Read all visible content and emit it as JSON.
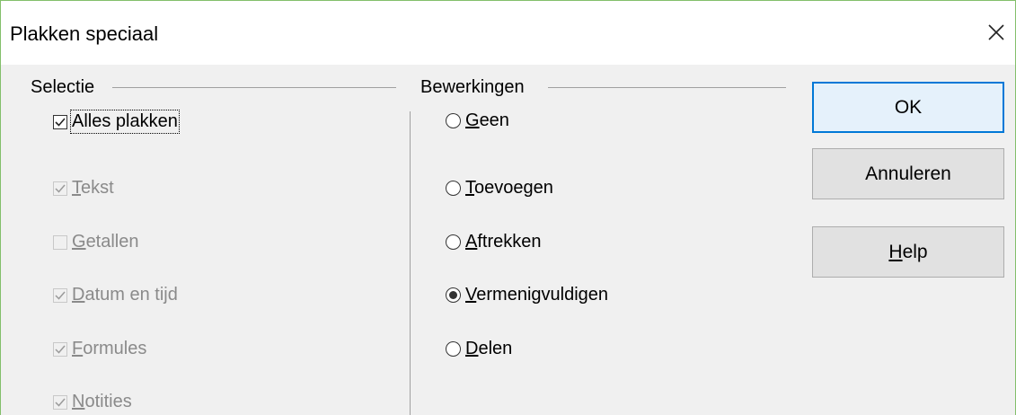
{
  "dialog": {
    "title": "Plakken speciaal",
    "close_icon": "close-icon"
  },
  "selection": {
    "title": "Selectie",
    "items": [
      {
        "first": "",
        "underline": "",
        "rest": "Alles plakken",
        "checked": true,
        "enabled": true
      },
      {
        "first": "",
        "underline": "T",
        "rest": "ekst",
        "checked": true,
        "enabled": false
      },
      {
        "first": "",
        "underline": "G",
        "rest": "etallen",
        "checked": false,
        "enabled": false
      },
      {
        "first": "",
        "underline": "D",
        "rest": "atum en tijd",
        "checked": true,
        "enabled": false
      },
      {
        "first": "",
        "underline": "F",
        "rest": "ormules",
        "checked": true,
        "enabled": false
      },
      {
        "first": "",
        "underline": "N",
        "rest": "otities",
        "checked": true,
        "enabled": false
      }
    ]
  },
  "operations": {
    "title": "Bewerkingen",
    "items": [
      {
        "underline": "G",
        "rest": "een",
        "selected": false
      },
      {
        "underline": "T",
        "rest": "oevoegen",
        "selected": false
      },
      {
        "underline": "A",
        "rest": "ftrekken",
        "selected": false
      },
      {
        "underline": "V",
        "rest": "ermenigvuldigen",
        "selected": true
      },
      {
        "underline": "D",
        "rest": "elen",
        "selected": false
      }
    ]
  },
  "buttons": {
    "ok": "OK",
    "cancel": "Annuleren",
    "help_underline": "H",
    "help_rest": "elp"
  }
}
